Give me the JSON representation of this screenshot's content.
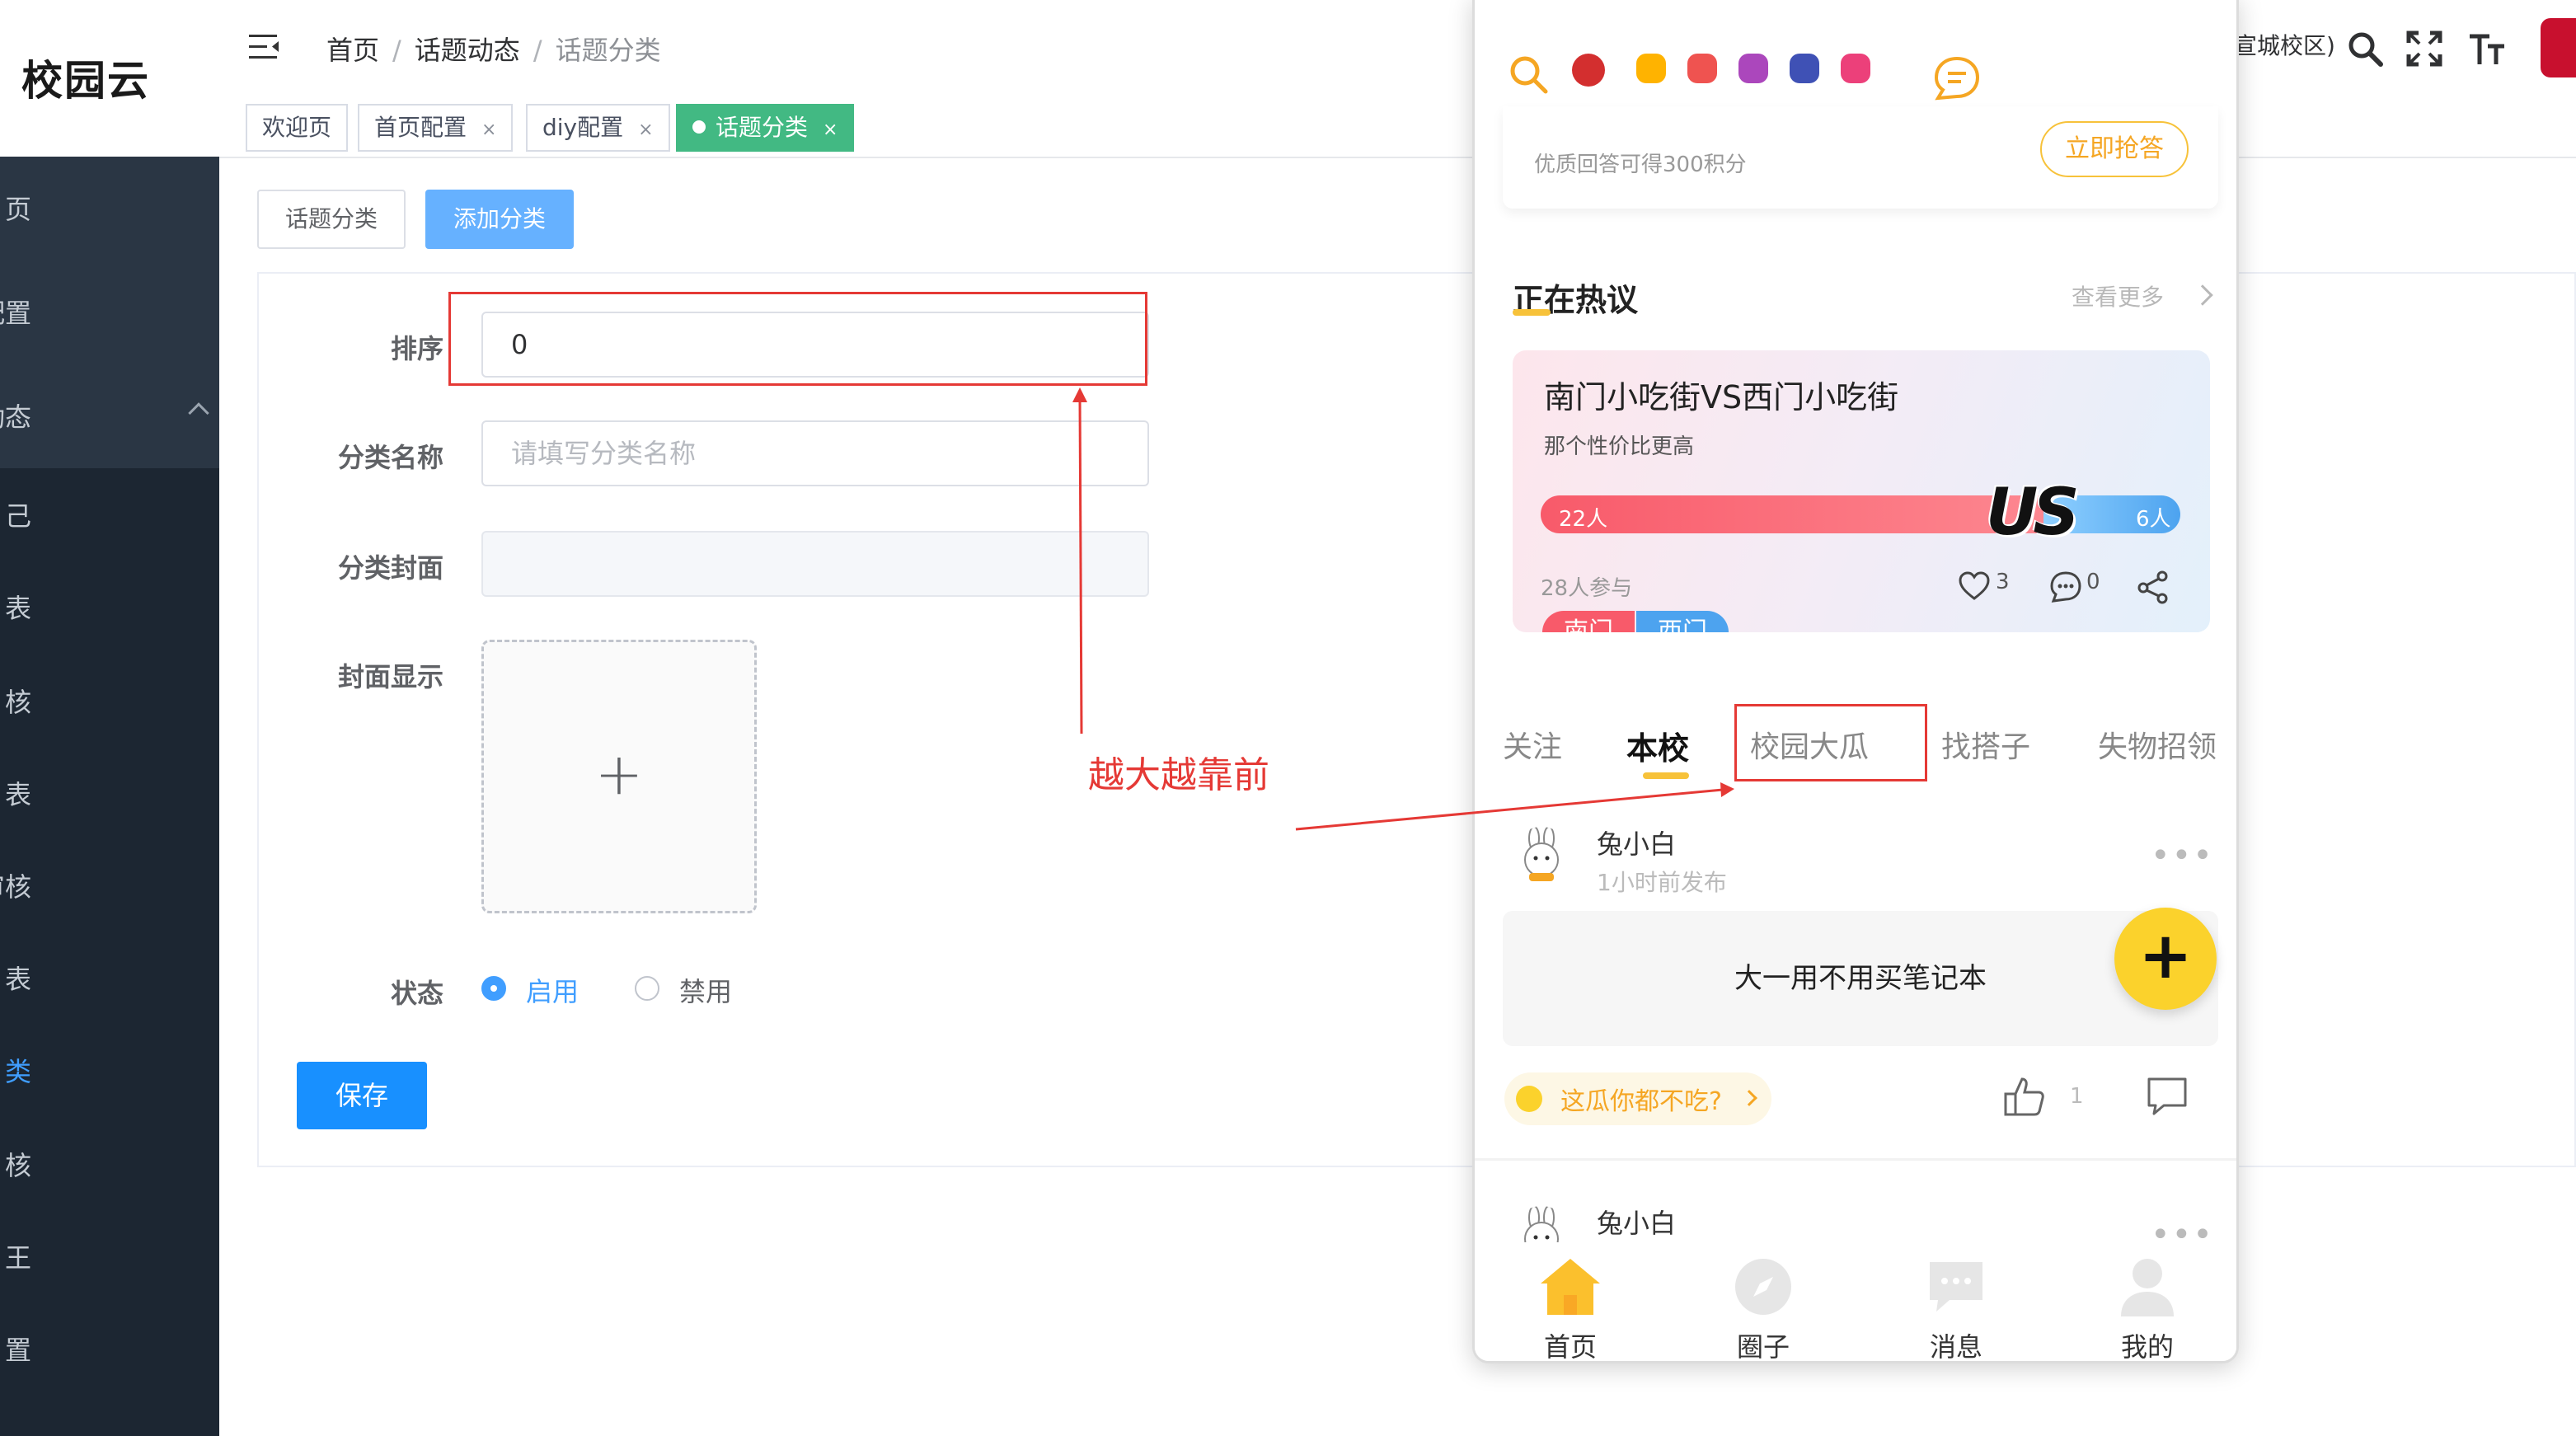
{
  "app": {
    "logo": "校园云"
  },
  "breadcrumb": [
    "首页",
    "话题动态",
    "话题分类"
  ],
  "header": {
    "campus_text": "宣城校区)"
  },
  "tags": [
    {
      "label": "欢迎页"
    },
    {
      "label": "首页配置",
      "close": "×"
    },
    {
      "label": "diy配置",
      "close": "×"
    },
    {
      "label": "话题分类",
      "close": "×"
    }
  ],
  "sidebar": {
    "items": [
      "页",
      "配置",
      "动态",
      "己",
      "表",
      "核",
      "表",
      "质审核",
      "表",
      "类",
      "核",
      "王",
      "置"
    ]
  },
  "toolbar": {
    "btn_category": "话题分类",
    "btn_add": "添加分类"
  },
  "form": {
    "sort_label": "排序",
    "sort_value": "0",
    "name_label": "分类名称",
    "name_placeholder": "请填写分类名称",
    "cover_label": "分类封面",
    "cover_display_label": "封面显示",
    "upload_plus": "+",
    "status_label": "状态",
    "status_enabled": "启用",
    "status_disabled": "禁用",
    "save": "保存"
  },
  "annotation": {
    "note": "越大越靠前"
  },
  "phone": {
    "answer_reward_text": "优质回答可得300积分",
    "answer_button": "立即抢答",
    "hot_title": "正在热议",
    "hot_more": "查看更多",
    "debate": {
      "title": "南门小吃街VS西门小吃街",
      "subtitle": "那个性价比更高",
      "left_votes": "22人",
      "right_votes": "6人",
      "vs": "US",
      "participants": "28人参与",
      "likes": "3",
      "comments": "0",
      "side_a": "南门",
      "side_b": "西门",
      "left_share": 0.786
    },
    "tabs": [
      "关注",
      "本校",
      "校园大瓜",
      "找搭子",
      "失物招领"
    ],
    "post1": {
      "author": "兔小白",
      "time": "1小时前发布",
      "more": "•••",
      "body": "大一用不用买笔记本",
      "tag": "这瓜你都不吃?",
      "likes": "1"
    },
    "post2": {
      "author": "兔小白",
      "more": "•••"
    },
    "fab": "+",
    "tabbar": [
      "首页",
      "圈子",
      "消息",
      "我的"
    ]
  },
  "colors": {
    "primary": "#409eff",
    "tag_active": "#42b983",
    "sidebar_bg": "#1c2632",
    "annotation_red": "#e53935",
    "phone_accent": "#f7c23a",
    "debate_left": "#f85a6a",
    "debate_right": "#4da3ef"
  },
  "icons": {
    "menu_toggle": "menu-fold-icon",
    "header": [
      "search-icon",
      "fullscreen-icon",
      "font-size-icon"
    ],
    "phone": [
      "search-icon",
      "chat-bubble-icon",
      "heart-icon",
      "comment-icon",
      "share-icon",
      "thumb-up-icon",
      "home-icon",
      "compass-icon",
      "message-icon",
      "user-icon"
    ]
  }
}
